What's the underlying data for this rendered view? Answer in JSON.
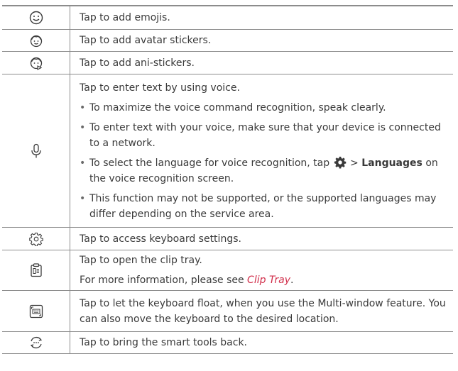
{
  "rows": {
    "emoji": {
      "icon": "emoji-icon",
      "text": "Tap to add emojis."
    },
    "avatar": {
      "icon": "avatar-sticker-icon",
      "text": "Tap to add avatar stickers."
    },
    "ani": {
      "icon": "ani-sticker-icon",
      "text": "Tap to add ani-stickers."
    },
    "voice": {
      "icon": "microphone-icon",
      "text": "Tap to enter text by using voice.",
      "bullet1": "To maximize the voice command recognition, speak clearly.",
      "bullet2": "To enter text with your voice, make sure that your device is connected to a network.",
      "bullet3_pre": "To select the language for voice recognition, tap",
      "bullet3_arrow": ">",
      "bullet3_strong": "Languages",
      "bullet3_post": "on the voice recognition screen.",
      "bullet4": "This function may not be supported, or the supported languages may differ depending on the service area.",
      "bullet_glyph": "•"
    },
    "settings": {
      "icon": "settings-gear-icon",
      "text": "Tap to access keyboard settings."
    },
    "clip": {
      "icon": "clip-tray-icon",
      "text": "Tap to open the clip tray.",
      "more_pre": "For more information, please see",
      "more_link": "Clip Tray",
      "more_post": "."
    },
    "float": {
      "icon": "floating-keyboard-icon",
      "text": "Tap to let the keyboard float, when you use the Multi-window feature. You can also move the keyboard to the desired location."
    },
    "smart": {
      "icon": "smart-tools-icon",
      "text": "Tap to bring the smart tools back."
    }
  },
  "colors": {
    "link": "#d12e4a",
    "rule": "#8c8c8c",
    "text": "#3a3a3a"
  }
}
